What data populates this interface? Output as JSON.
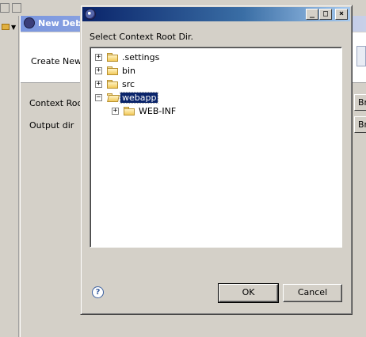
{
  "background_window": {
    "title": "New Debu",
    "banner_text": "Create New",
    "fields": [
      {
        "label": "Context Root",
        "button_label": "Br"
      },
      {
        "label": "Output dir",
        "button_label": "Br"
      }
    ]
  },
  "dialog": {
    "title": "",
    "controls": {
      "minimize": "_",
      "maximize": "□",
      "close": "×"
    },
    "message": "Select Context Root Dir.",
    "tree": [
      {
        "label": ".settings",
        "expander": "+",
        "selected": false,
        "level": 0
      },
      {
        "label": "bin",
        "expander": "+",
        "selected": false,
        "level": 0
      },
      {
        "label": "src",
        "expander": "+",
        "selected": false,
        "level": 0
      },
      {
        "label": "webapp",
        "expander": "−",
        "selected": true,
        "level": 0
      },
      {
        "label": "WEB-INF",
        "expander": "+",
        "selected": false,
        "level": 1
      }
    ],
    "help_glyph": "?",
    "ok_label": "OK",
    "cancel_label": "Cancel"
  },
  "colors": {
    "selection": "#0a246a",
    "titlebar_active": "#0a246a",
    "titlebar_inactive": "#7a96df"
  }
}
